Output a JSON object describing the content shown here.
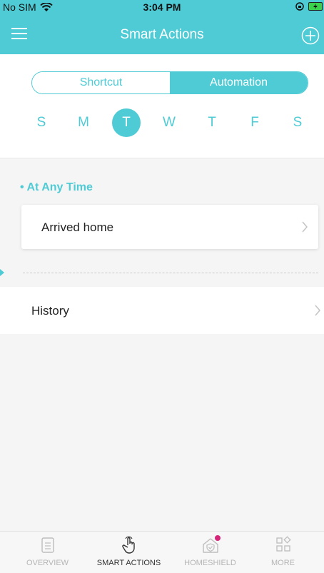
{
  "status_bar": {
    "carrier": "No SIM",
    "time": "3:04 PM"
  },
  "nav": {
    "title": "Smart Actions",
    "menu_icon": "hamburger-menu-icon",
    "add_icon": "circle-plus-icon"
  },
  "segments": {
    "shortcut": "Shortcut",
    "automation": "Automation",
    "selected": "Automation"
  },
  "days": [
    "S",
    "M",
    "T",
    "W",
    "T",
    "F",
    "S"
  ],
  "selected_day_index": 2,
  "section": {
    "label": "• At Any Time"
  },
  "automation_items": [
    {
      "label": "Arrived home"
    }
  ],
  "history": {
    "label": "History"
  },
  "tabbar": {
    "items": [
      {
        "label": "OVERVIEW",
        "icon": "document-icon",
        "active": false
      },
      {
        "label": "SMART ACTIONS",
        "icon": "pointer-hand-icon",
        "active": true
      },
      {
        "label": "HOMESHIELD",
        "icon": "shield-house-icon",
        "active": false,
        "badge": true
      },
      {
        "label": "MORE",
        "icon": "grid-icon",
        "active": false
      }
    ]
  },
  "colors": {
    "accent": "#4fcbd5",
    "badge": "#d6267a"
  }
}
